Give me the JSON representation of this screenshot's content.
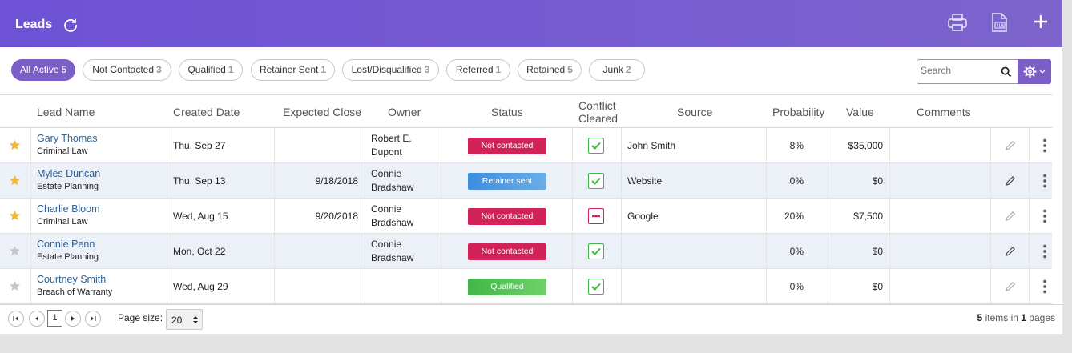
{
  "header": {
    "title": "Leads"
  },
  "filters": [
    {
      "label": "All Active",
      "count": "5",
      "active": true
    },
    {
      "label": "Not Contacted",
      "count": "3"
    },
    {
      "label": "Qualified",
      "count": "1"
    },
    {
      "label": "Retainer Sent",
      "count": "1"
    },
    {
      "label": "Lost/Disqualified",
      "count": "3"
    },
    {
      "label": "Referred",
      "count": "1"
    },
    {
      "label": "Retained",
      "count": "5"
    },
    {
      "label": "Junk",
      "count": "2"
    }
  ],
  "search": {
    "placeholder": "Search"
  },
  "columns": {
    "lead_name": "Lead Name",
    "created_date": "Created Date",
    "expected_close": "Expected Close",
    "owner": "Owner",
    "status": "Status",
    "conflict_line1": "Conflict",
    "conflict_line2": "Cleared",
    "source": "Source",
    "probability": "Probability",
    "value": "Value",
    "comments": "Comments"
  },
  "rows": [
    {
      "starred": true,
      "name": "Gary Thomas",
      "practice": "Criminal Law",
      "created": "Thu, Sep 27",
      "close": "",
      "owner1": "Robert E.",
      "owner2": "Dupont",
      "status": "Not contacted",
      "status_color": "#d12358",
      "conflict": "cleared",
      "source": "John Smith",
      "probability": "8%",
      "value": "$35,000",
      "comments": ""
    },
    {
      "starred": true,
      "name": "Myles Duncan",
      "practice": "Estate Planning",
      "created": "Thu, Sep 13",
      "close": "9/18/2018",
      "owner1": "Connie",
      "owner2": "Bradshaw",
      "status": "Retainer sent",
      "status_color": "#3d8de0",
      "conflict": "cleared",
      "source": "Website",
      "probability": "0%",
      "value": "$0",
      "comments": ""
    },
    {
      "starred": true,
      "name": "Charlie Bloom",
      "practice": "Criminal Law",
      "created": "Wed, Aug 15",
      "close": "9/20/2018",
      "owner1": "Connie",
      "owner2": "Bradshaw",
      "status": "Not contacted",
      "status_color": "#d12358",
      "conflict": "not-cleared",
      "source": "Google",
      "probability": "20%",
      "value": "$7,500",
      "comments": ""
    },
    {
      "starred": false,
      "name": "Connie Penn",
      "practice": "Estate Planning",
      "created": "Mon, Oct 22",
      "close": "",
      "owner1": "Connie",
      "owner2": "Bradshaw",
      "status": "Not contacted",
      "status_color": "#d12358",
      "conflict": "cleared",
      "source": "",
      "probability": "0%",
      "value": "$0",
      "comments": ""
    },
    {
      "starred": false,
      "name": "Courtney Smith",
      "practice": "Breach of Warranty",
      "created": "Wed, Aug 29",
      "close": "",
      "owner1": "",
      "owner2": "",
      "status": "Qualified",
      "status_color": "#43b649",
      "conflict": "cleared",
      "source": "",
      "probability": "0%",
      "value": "$0",
      "comments": ""
    }
  ],
  "pager": {
    "current_page": "1",
    "page_size_label": "Page size:",
    "page_size": "20",
    "items_count": "5",
    "items_mid": "items in",
    "pages_count": "1",
    "pages_label": "pages"
  },
  "colors": {
    "header_start": "#6e52d6",
    "header_end": "#7c64cc",
    "accent": "#7c5fc6",
    "star_on": "#f5b82e",
    "star_off": "#c8c8c8",
    "link": "#2e5e92"
  },
  "icons": [
    "refresh-icon",
    "print-icon",
    "export-xls-icon",
    "plus-icon",
    "search-icon",
    "gear-icon",
    "chevron-down-icon",
    "star-icon",
    "checkbox-checked-icon",
    "minus-box-icon",
    "pencil-icon",
    "kebab-menu-icon",
    "first-page-icon",
    "prev-page-icon",
    "next-page-icon",
    "last-page-icon"
  ]
}
